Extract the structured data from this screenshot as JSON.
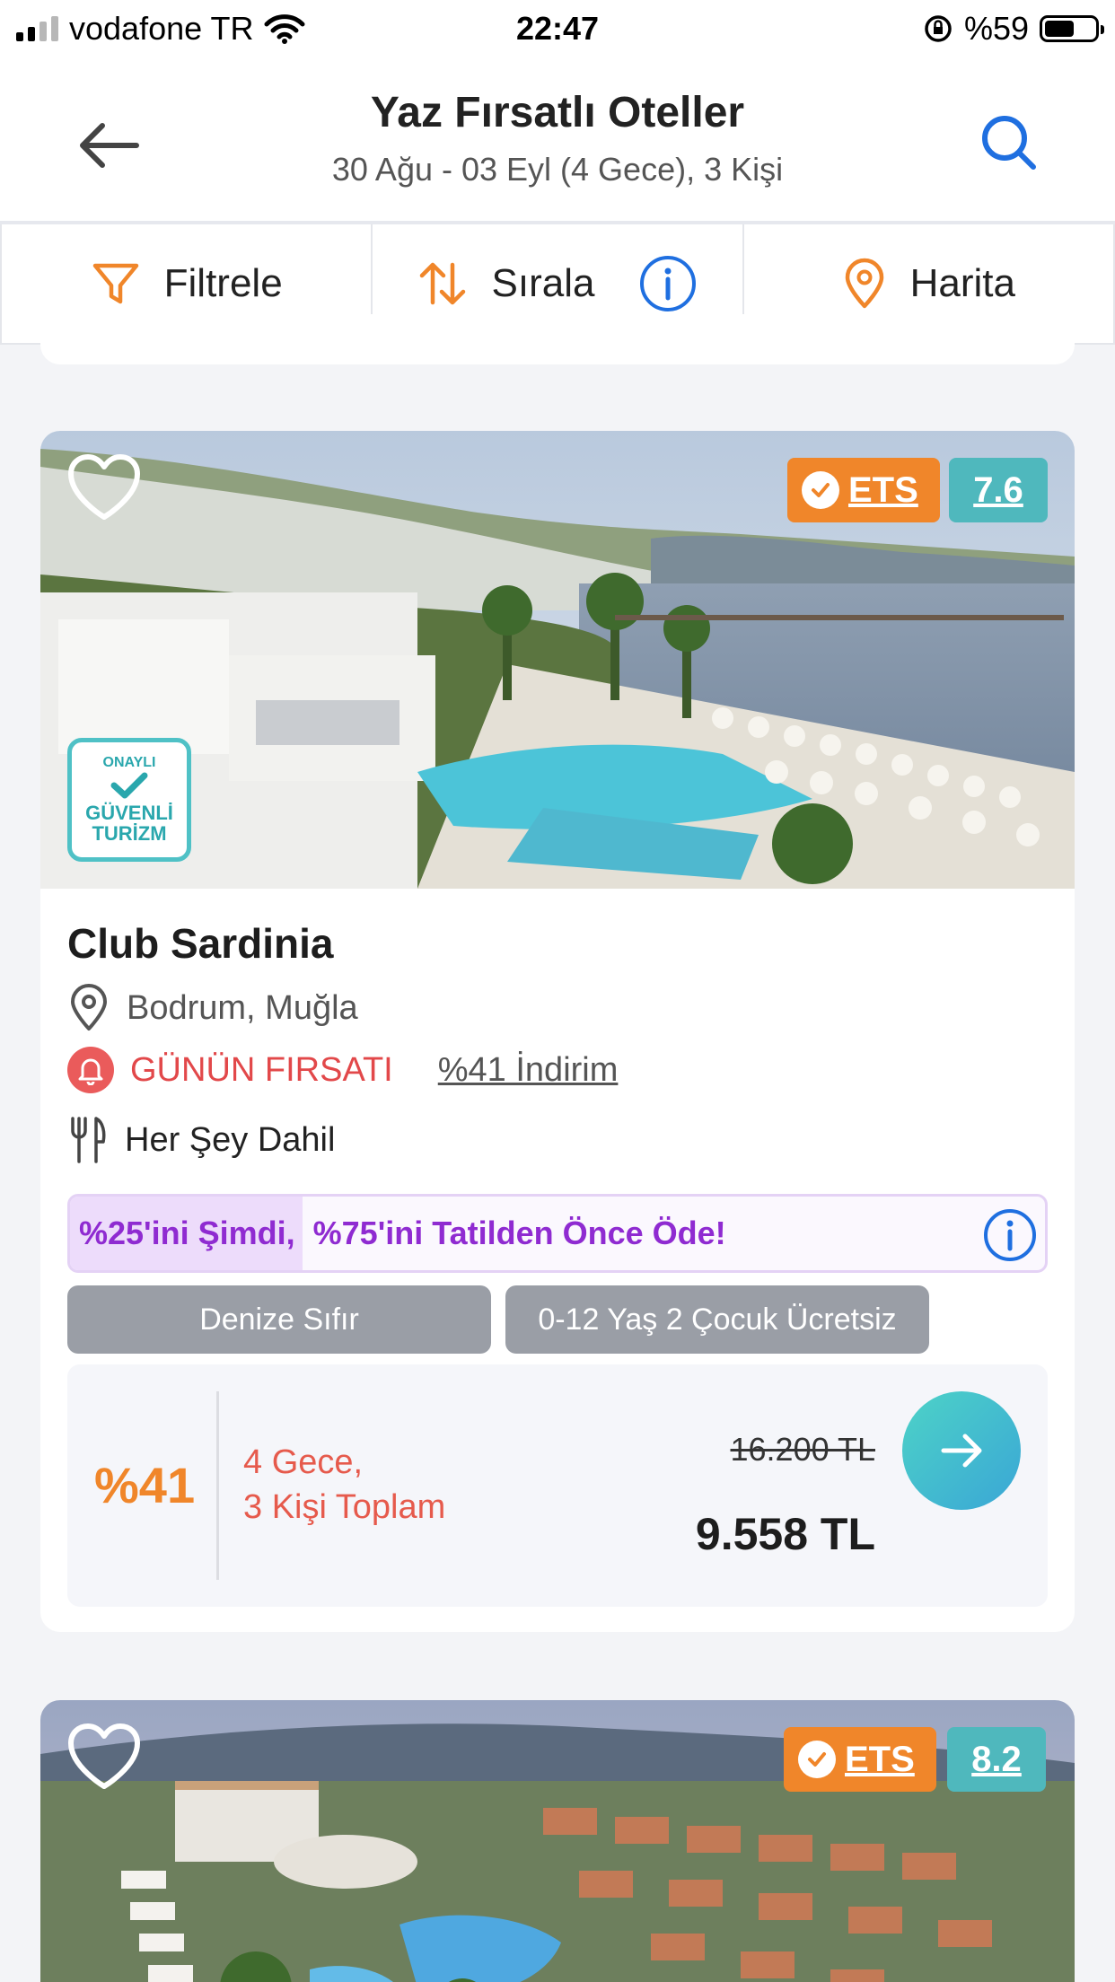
{
  "status_bar": {
    "carrier": "vodafone TR",
    "time": "22:47",
    "battery_percent": "%59",
    "battery_level": 0.59
  },
  "header": {
    "title": "Yaz Fırsatlı Oteller",
    "subtitle": "30 Ağu - 03 Eyl (4 Gece), 3 Kişi",
    "back_icon": "arrow-left-icon",
    "search_icon": "search-icon"
  },
  "toolbar": {
    "filter_label": "Filtrele",
    "sort_label": "Sırala",
    "map_label": "Harita"
  },
  "colors": {
    "accent_orange": "#f0862a",
    "score_teal": "#4fb8bd",
    "deal_red": "#e2484a",
    "pay_purple": "#8f2bd1",
    "link_blue": "#1f6fe0"
  },
  "hotels": [
    {
      "name": "Club Sardinia",
      "ets_label": "ETS",
      "score": "7.6",
      "safe_badge_top": "ONAYLI",
      "safe_badge_bottom": "GÜVENLİ TURİZM",
      "location": "Bodrum, Muğla",
      "deal_label": "GÜNÜN FIRSATI",
      "discount_link": "%41 İndirim",
      "board_type": "Her Şey Dahil",
      "pay_now": "%25'ini Şimdi,",
      "pay_rest": "%75'ini Tatilden Önce Öde!",
      "tags": [
        "Denize Sıfır",
        "0-12 Yaş 2 Çocuk Ücretsiz"
      ],
      "discount_pct": "%41",
      "stay_line1": "4 Gece,",
      "stay_line2": "3 Kişi Toplam",
      "old_price": "16.200 TL",
      "new_price": "9.558 TL"
    },
    {
      "ets_label": "ETS",
      "score": "8.2"
    }
  ]
}
